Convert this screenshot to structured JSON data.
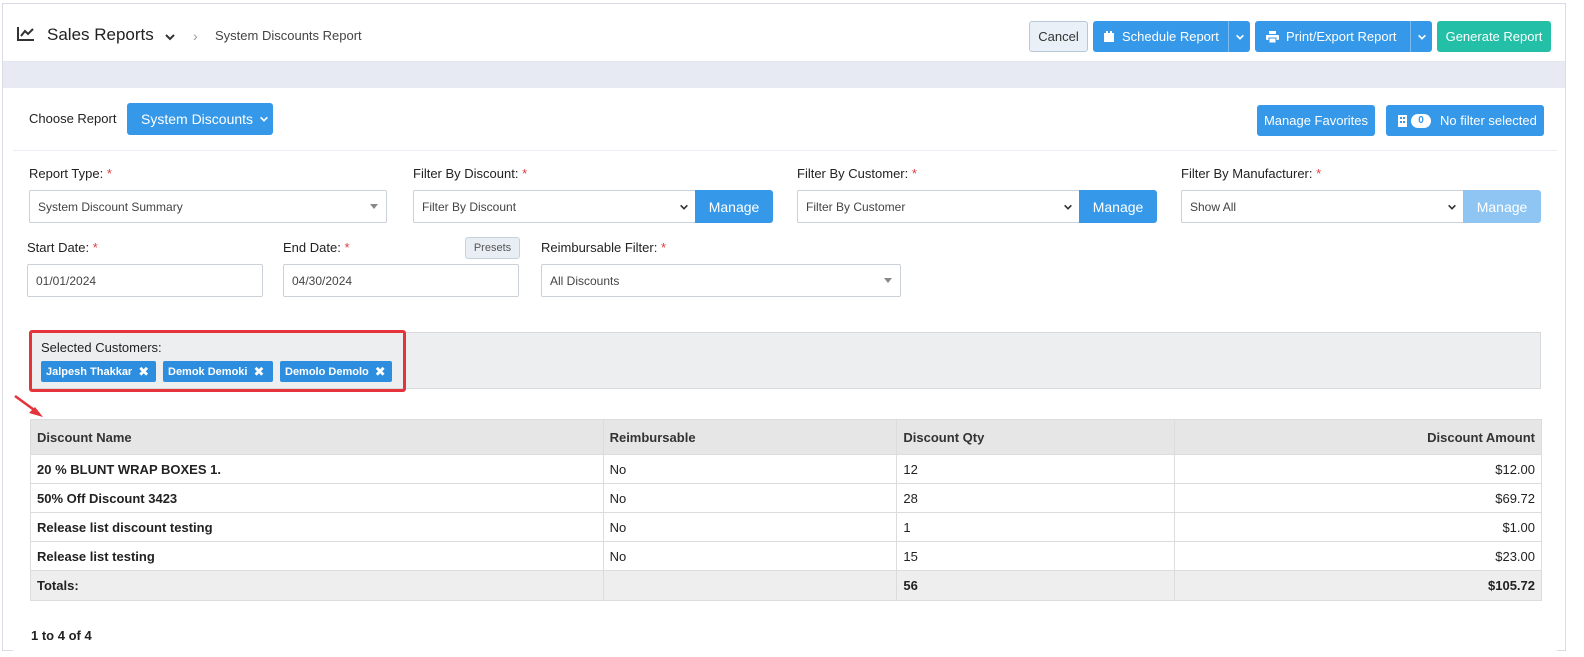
{
  "header": {
    "app_title": "Sales Reports",
    "breadcrumb": "System Discounts Report",
    "cancel_label": "Cancel",
    "schedule_label": "Schedule Report",
    "print_label": "Print/Export Report",
    "generate_label": "Generate Report"
  },
  "toolbar": {
    "choose_report_label": "Choose Report",
    "choose_report_value": "System Discounts",
    "manage_favorites_label": "Manage Favorites",
    "filter_count": "0",
    "filter_label": "No filter selected"
  },
  "filters": {
    "report_type_label": "Report Type:",
    "report_type_value": "System Discount Summary",
    "discount_label": "Filter By Discount:",
    "discount_value": "Filter By Discount",
    "customer_label": "Filter By Customer:",
    "customer_value": "Filter By Customer",
    "manufacturer_label": "Filter By Manufacturer:",
    "manufacturer_value": "Show All",
    "manage_label": "Manage",
    "start_date_label": "Start Date:",
    "start_date_value": "01/01/2024",
    "end_date_label": "End Date:",
    "end_date_value": "04/30/2024",
    "presets_label": "Presets",
    "reimbursable_label": "Reimbursable Filter:",
    "reimbursable_value": "All Discounts",
    "required_mark": "*"
  },
  "selected_customers": {
    "label": "Selected Customers:",
    "tags": [
      "Jalpesh Thakkar",
      "Demok Demoki",
      "Demolo Demolo"
    ]
  },
  "table": {
    "columns": [
      "Discount Name",
      "Reimbursable",
      "Discount Qty",
      "Discount Amount"
    ],
    "rows": [
      [
        "20 % BLUNT WRAP BOXES 1.",
        "No",
        "12",
        "$12.00"
      ],
      [
        "50% Off Discount 3423",
        "No",
        "28",
        "$69.72"
      ],
      [
        "Release list discount testing",
        "No",
        "1",
        "$1.00"
      ],
      [
        "Release list testing",
        "No",
        "15",
        "$23.00"
      ]
    ],
    "totals": [
      "Totals:",
      "",
      "56",
      "$105.72"
    ]
  },
  "pager": "1 to 4 of 4",
  "colors": {
    "primary": "#3598e8",
    "teal": "#23bfa6",
    "highlight": "#e5333b"
  }
}
